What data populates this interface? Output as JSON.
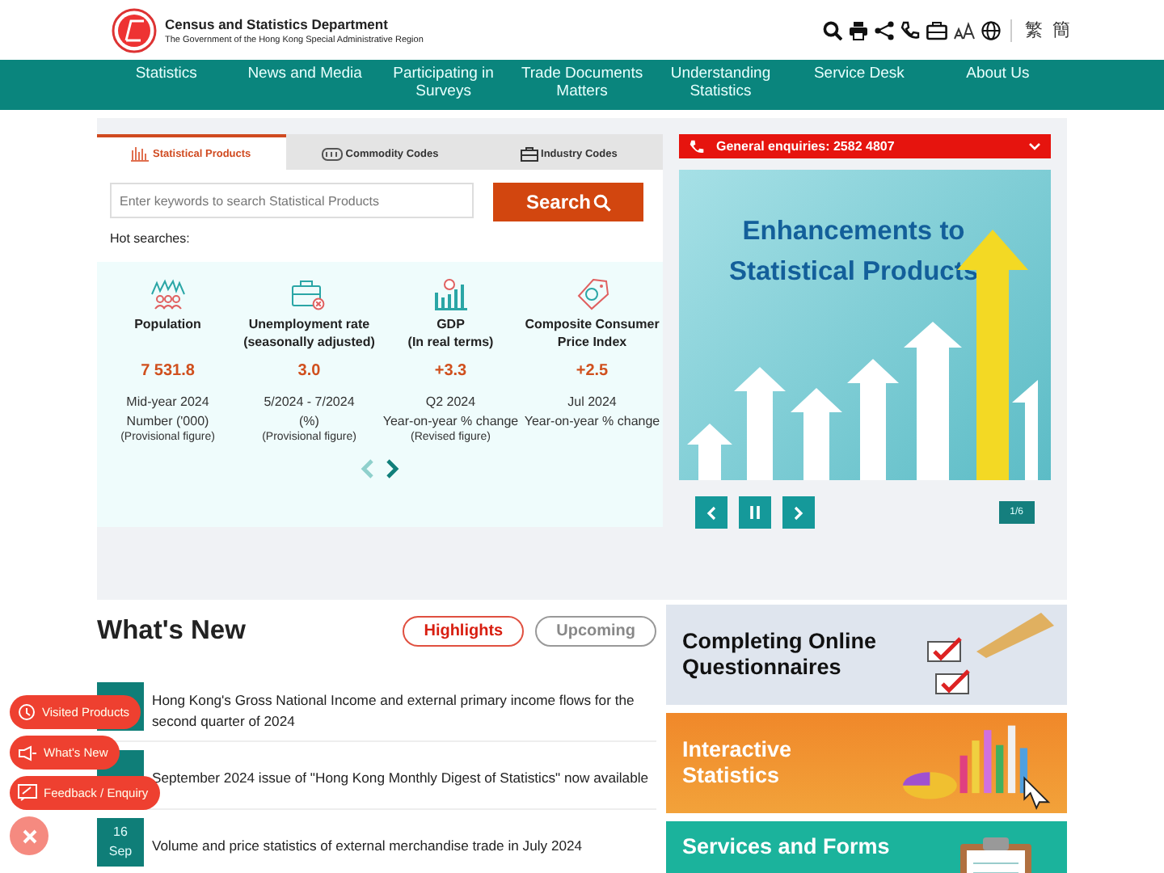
{
  "header": {
    "title": "Census and Statistics Department",
    "subtitle": "The Government of the Hong Kong Special Administrative Region",
    "languages": [
      "繁",
      "簡"
    ]
  },
  "nav": [
    "Statistics",
    "News and Media",
    "Participating in Surveys",
    "Trade Documents Matters",
    "Understanding Statistics",
    "Service Desk",
    "About Us"
  ],
  "tabs": [
    {
      "label": "Statistical Products",
      "selected": true
    },
    {
      "label": "Commodity Codes",
      "selected": false
    },
    {
      "label": "Industry Codes",
      "selected": false
    }
  ],
  "search": {
    "placeholder": "Enter keywords to search Statistical Products",
    "button": "Search"
  },
  "hot_searches": "Hot searches:",
  "indicators": [
    {
      "kind": "population",
      "title_lines": [
        "Population"
      ],
      "value": "7 531.8",
      "notes": [
        "Mid-year 2024",
        "Number ('000)",
        "(Provisional figure)"
      ]
    },
    {
      "kind": "unemployment",
      "title_lines": [
        "Unemployment rate",
        "(seasonally adjusted)"
      ],
      "value": "3.0",
      "notes": [
        "5/2024 - 7/2024",
        "(%)",
        "(Provisional figure)"
      ]
    },
    {
      "kind": "gdp",
      "title_lines": [
        "GDP",
        "(In real terms)"
      ],
      "value": "+3.3",
      "notes": [
        "Q2 2024",
        "Year-on-year % change",
        "(Revised figure)"
      ]
    },
    {
      "kind": "cpi",
      "title_lines": [
        "Composite Consumer",
        "Price Index"
      ],
      "value": "+2.5",
      "notes": [
        "Jul 2024",
        "Year-on-year % change"
      ]
    }
  ],
  "enquiry": "General enquiries: 2582 4807",
  "slide": {
    "title": "Enhancements to Statistical Products",
    "counter": "1/6"
  },
  "whats_new": {
    "title": "What's New",
    "filters": [
      {
        "label": "Highlights",
        "selected": true
      },
      {
        "label": "Upcoming",
        "selected": false
      }
    ],
    "items": [
      {
        "text": "Hong Kong's Gross National Income and external primary income flows for the second quarter of 2024"
      },
      {
        "text": "September 2024 issue of \"Hong Kong Monthly Digest of Statistics\" now available"
      },
      {
        "day": "16",
        "month": "Sep",
        "text": "Volume and price statistics of external merchandise trade in July 2024"
      }
    ]
  },
  "tiles": [
    {
      "kind": "questionnaire",
      "title": "Completing Online Questionnaires"
    },
    {
      "kind": "interactive",
      "title": "Interactive Statistics"
    },
    {
      "kind": "forms",
      "title": "Services and Forms"
    }
  ],
  "floating": [
    {
      "kind": "history",
      "label": "Visited Products"
    },
    {
      "kind": "news",
      "label": "What's New"
    },
    {
      "kind": "feedback",
      "label": "Feedback / Enquiry"
    }
  ]
}
